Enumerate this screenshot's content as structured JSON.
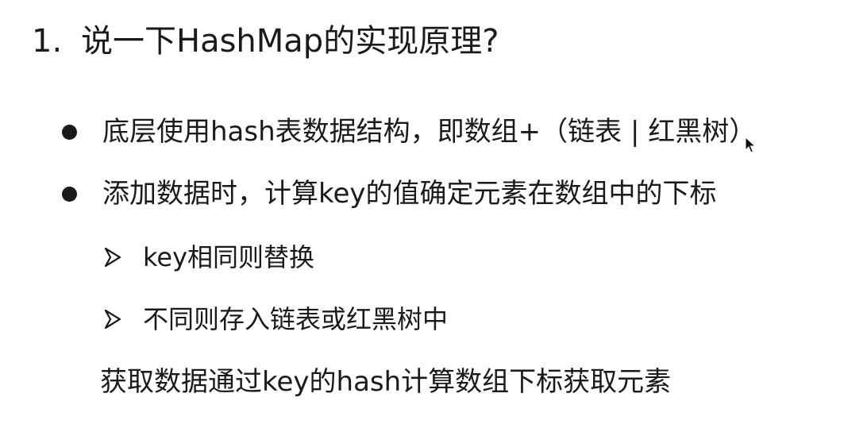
{
  "title": {
    "number": "1.",
    "text": "说一下HashMap的实现原理?"
  },
  "bullets": [
    {
      "text": "底层使用hash表数据结构，即数组+（链表 | 红黑树）"
    },
    {
      "text": "添加数据时，计算key的值确定元素在数组中的下标"
    }
  ],
  "sub_items": [
    {
      "text": "key相同则替换"
    },
    {
      "text": "不同则存入链表或红黑树中"
    }
  ],
  "summary": "获取数据通过key的hash计算数组下标获取元素",
  "icons": {
    "bullet": "filled-circle",
    "sub_bullet": "arrowhead",
    "pointer": "mouse-pointer-icon"
  }
}
